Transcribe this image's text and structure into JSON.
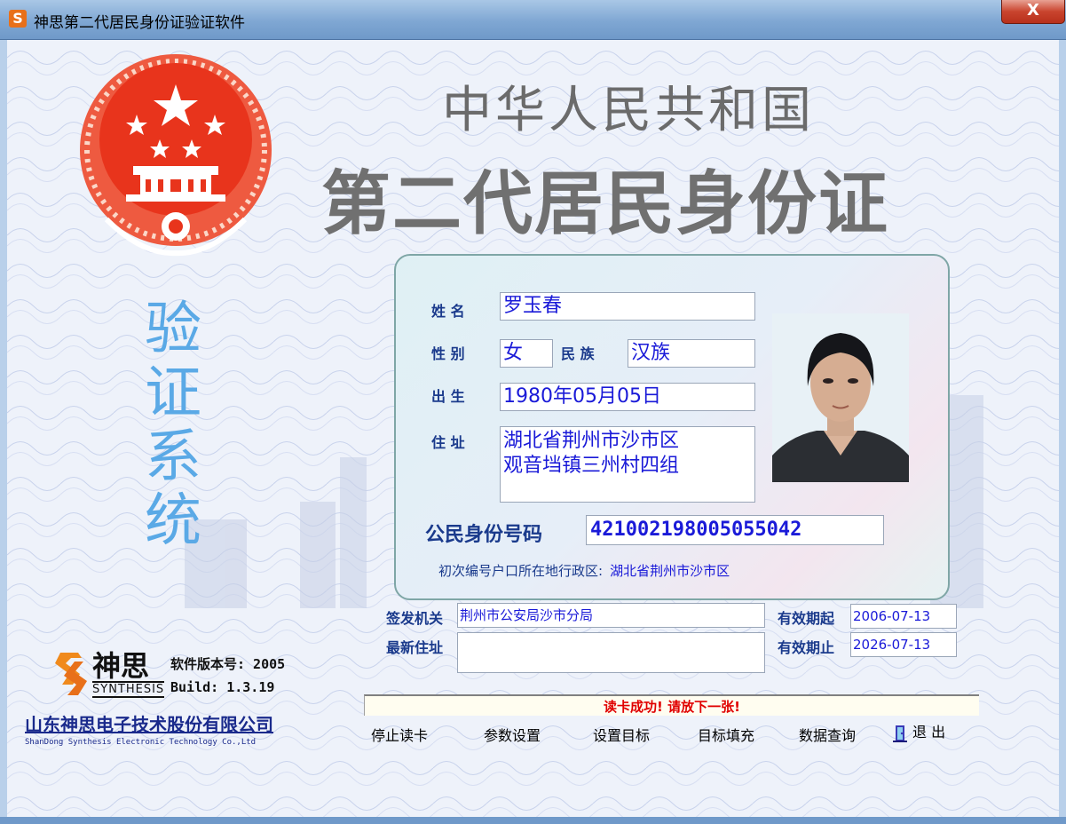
{
  "window": {
    "title": "神思第二代居民身份证验证软件",
    "close_label": "X",
    "app_icon_glyph": "S"
  },
  "header": {
    "line1": "中华人民共和国",
    "line2": "第二代居民身份证"
  },
  "side_title": {
    "chars": [
      "验",
      "证",
      "系",
      "统"
    ]
  },
  "card": {
    "name_label": "姓  名",
    "name": "罗玉春",
    "sex_label": "性  别",
    "sex": "女",
    "ethnicity_label": "民  族",
    "ethnicity": "汉族",
    "birth_label": "出  生",
    "birth": "1980年05月05日",
    "address_label": "住  址",
    "address_line1": "湖北省荆州市沙市区",
    "address_line2": "观音垱镇三州村四组",
    "id_label": "公民身份号码",
    "id_number": "421002198005055042",
    "region_label": "初次编号户口所在地行政区:",
    "region_value": "湖北省荆州市沙市区"
  },
  "details": {
    "authority_label": "签发机关",
    "authority": "荆州市公安局沙市分局",
    "new_address_label": "最新住址",
    "new_address": "",
    "valid_from_label": "有效期起",
    "valid_from": "2006-07-13",
    "valid_to_label": "有效期止",
    "valid_to": "2026-07-13"
  },
  "status": {
    "message": "读卡成功! 请放下一张!"
  },
  "toolbar": {
    "stop": "停止读卡",
    "settings": "参数设置",
    "set_target": "设置目标",
    "fill_target": "目标填充",
    "query": "数据查询",
    "exit": "退  出"
  },
  "branding": {
    "logo_cn": "神思",
    "logo_en": "SYNTHESIS",
    "version": "软件版本号: 2005",
    "build": "Build:  1.3.19",
    "company_cn": "山东神思电子技术股份有限公司",
    "company_en": "ShanDong Synthesis Electronic Technology Co.,Ltd"
  },
  "colors": {
    "accent_blue": "#1a1ad8",
    "label_blue": "#1a3a8c",
    "status_red": "#e00000",
    "side_title_blue": "#5aa9e6"
  },
  "icons": [
    "app-icon",
    "national-emblem",
    "id-photo",
    "exit-icon",
    "synthesis-logo"
  ]
}
